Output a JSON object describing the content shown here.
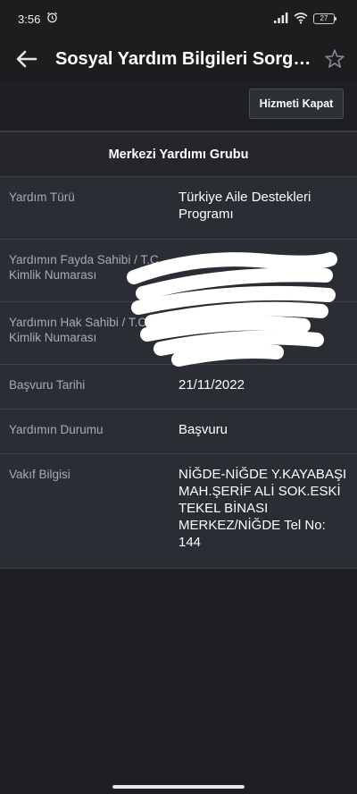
{
  "status_bar": {
    "time": "3:56",
    "battery": "27",
    "icons": [
      "alarm-icon",
      "signal-icon",
      "wifi-icon",
      "battery-icon"
    ]
  },
  "app_bar": {
    "title": "Sosyal Yardım Bilgileri Sorgulama",
    "back_icon": "arrow-left-icon",
    "favorite_icon": "star-outline-icon"
  },
  "actions": {
    "close_service_label": "Hizmeti Kapat"
  },
  "section": {
    "title": "Merkezi Yardımı Grubu",
    "rows": [
      {
        "label": "Yardım Türü",
        "value": "Türkiye Aile Destekleri Programı"
      },
      {
        "label": "Yardımın Fayda Sahibi / T.C. Kimlik Numarası",
        "value": ""
      },
      {
        "label": "Yardımın Hak Sahibi / T.C. Kimlik Numarası",
        "value": ""
      },
      {
        "label": "Başvuru Tarihi",
        "value": "21/11/2022"
      },
      {
        "label": "Yardımın Durumu",
        "value": "Başvuru"
      },
      {
        "label": "Vakıf Bilgisi",
        "value": "NİĞDE-NİĞDE Y.KAYABAŞI MAH.ŞERİF ALİ SOK.ESKİ TEKEL BİNASI MERKEZ/NİĞDE Tel No: 144"
      }
    ]
  },
  "colors": {
    "background": "#1e1f22",
    "row_background": "#2a2d33",
    "label_text": "#a7abb3",
    "value_text": "#ffffff",
    "redaction": "#ffffff"
  }
}
